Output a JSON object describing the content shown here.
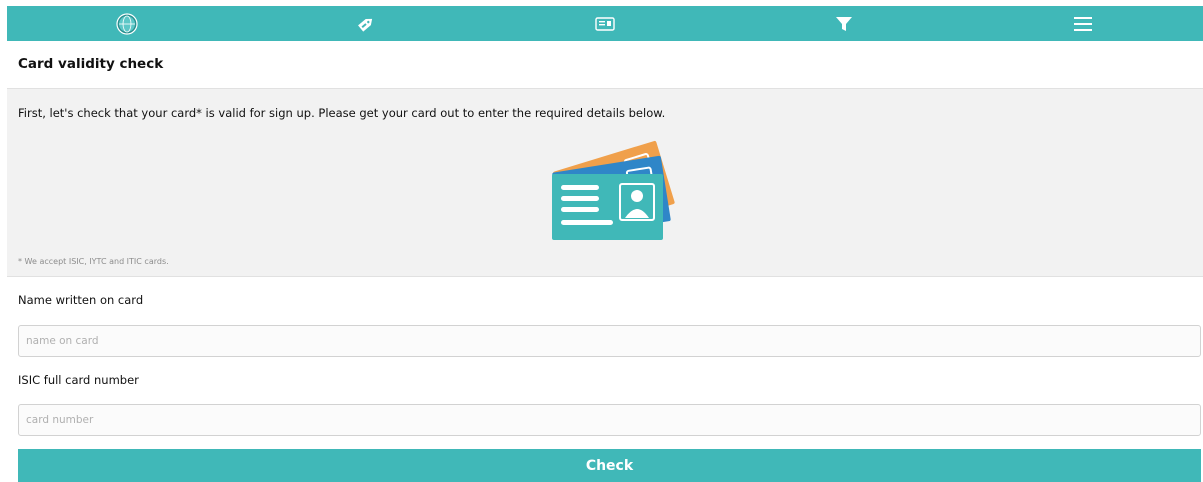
{
  "nav": {
    "items": [
      {
        "icon": "globe-logo-icon"
      },
      {
        "icon": "discount-tag-icon"
      },
      {
        "icon": "id-card-icon"
      },
      {
        "icon": "filter-icon"
      },
      {
        "icon": "hamburger-menu-icon"
      }
    ]
  },
  "page": {
    "title": "Card validity check",
    "intro": "First, let's check that your card* is valid for sign up. Please get your card out to enter the required details below.",
    "footnote": "* We accept ISIC, IYTC and ITIC cards."
  },
  "form": {
    "name_label": "Name written on card",
    "name_placeholder": "name on card",
    "name_value": "",
    "number_label": "ISIC full card number",
    "number_placeholder": "card number",
    "number_value": "",
    "submit_label": "Check"
  },
  "colors": {
    "accent": "#40b8b8",
    "card_orange": "#f0a04b",
    "card_blue": "#2f86c8",
    "card_teal": "#40b8b8"
  }
}
